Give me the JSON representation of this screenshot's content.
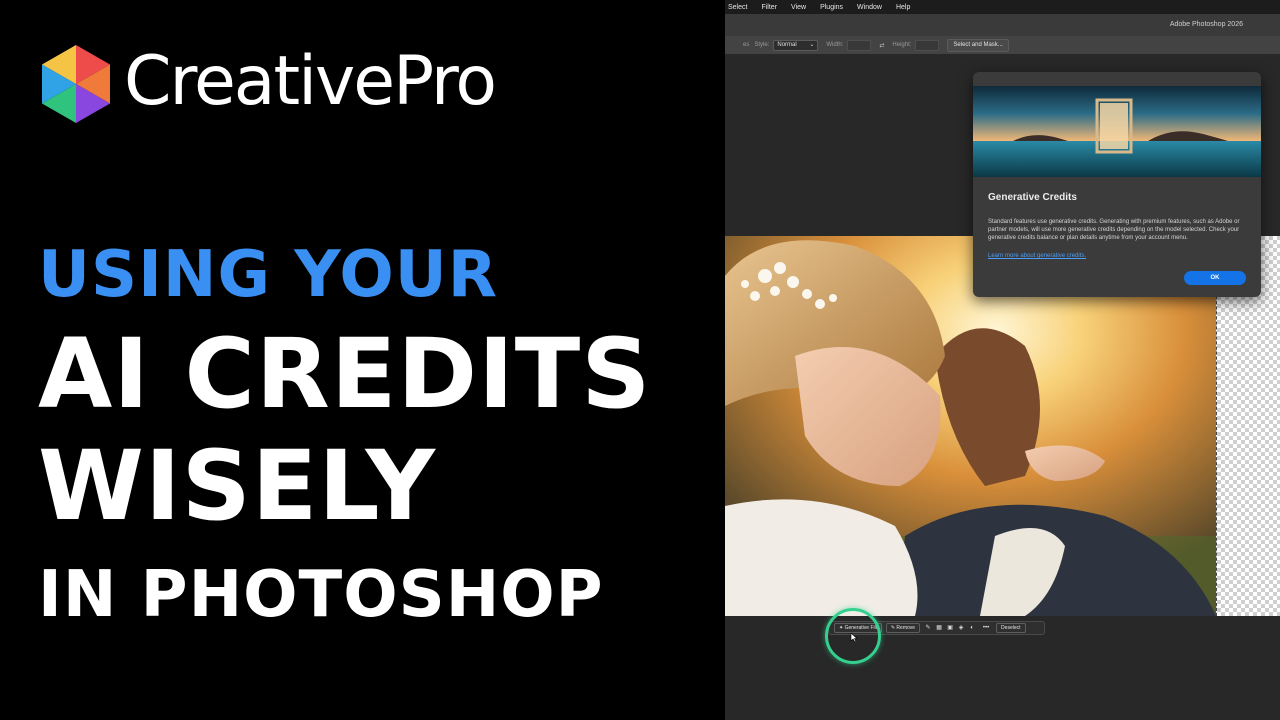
{
  "brand": {
    "name": "CreativePro"
  },
  "headline": {
    "line1": "USING YOUR",
    "line2": "AI CREDITS",
    "line3": "WISELY",
    "line4": "IN PHOTOSHOP"
  },
  "colors": {
    "accent_blue": "#3a8ff2",
    "highlight_green": "#35d08f",
    "ok_button": "#1473e6",
    "link": "#4c9df7"
  },
  "photoshop": {
    "menu": [
      "Select",
      "Filter",
      "View",
      "Plugins",
      "Window",
      "Help"
    ],
    "app_title": "Adobe Photoshop 2026",
    "options_bar": {
      "partial_label": "es",
      "style_label": "Style:",
      "style_value": "Normal",
      "width_label": "Width:",
      "swap_icon": "swap-icon",
      "height_label": "Height:",
      "select_mask_label": "Select and Mask..."
    },
    "task_bar": {
      "generative_fill_label": "Generative Fill",
      "remove_label": "Remove",
      "more_label": "•••",
      "deselect_label": "Deselect"
    },
    "dialog": {
      "title": "Generative Credits",
      "body": "Standard features use generative credits. Generating with premium features, such as Adobe or partner models, will use more generative credits depending on the model selected. Check your generative credits balance or plan details anytime from your account menu.",
      "link": "Learn more about generative credits.",
      "ok_label": "OK"
    }
  }
}
